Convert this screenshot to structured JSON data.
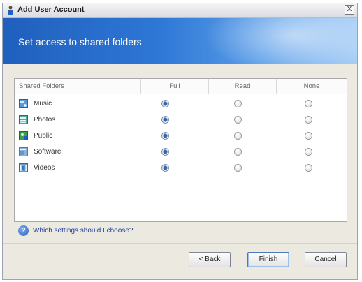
{
  "window": {
    "title": "Add User Account",
    "close_label": "X"
  },
  "banner": {
    "title": "Set access to shared folders"
  },
  "table": {
    "columns": [
      "Shared Folders",
      "Full",
      "Read",
      "None"
    ],
    "rows": [
      {
        "name": "Music",
        "access": "Full"
      },
      {
        "name": "Photos",
        "access": "Full"
      },
      {
        "name": "Public",
        "access": "Full"
      },
      {
        "name": "Software",
        "access": "Full"
      },
      {
        "name": "Videos",
        "access": "Full"
      }
    ]
  },
  "help": {
    "link_text": "Which settings should I choose?"
  },
  "buttons": {
    "back": "< Back",
    "finish": "Finish",
    "cancel": "Cancel"
  },
  "colors": {
    "banner": "#2f78d6",
    "selected_radio": "#3a66a8",
    "link": "#1d3f9e"
  }
}
